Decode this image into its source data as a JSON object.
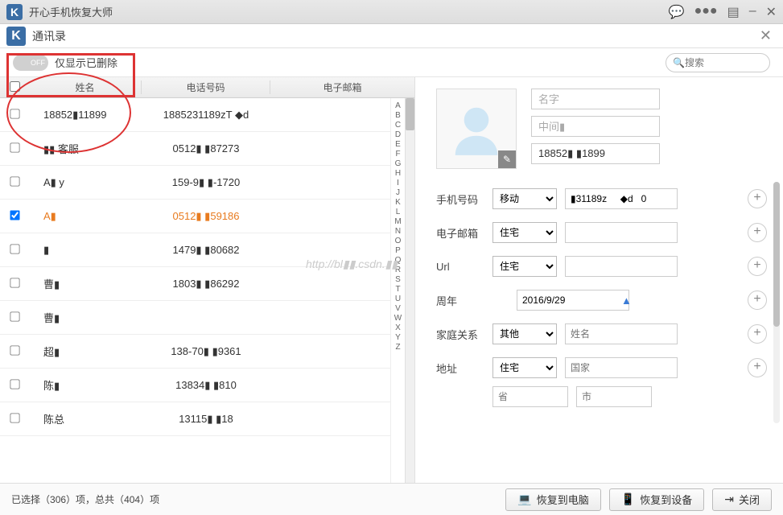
{
  "app": {
    "logo_text": "K",
    "title": "开心手机恢复大师"
  },
  "subheader": {
    "title": "通讯录"
  },
  "toolbar": {
    "toggle_state": "OFF",
    "toggle_label": "仅显示已删除",
    "search_placeholder": "搜索"
  },
  "columns": {
    "name": "姓名",
    "phone": "电话号码",
    "email": "电子邮箱"
  },
  "contacts": [
    {
      "checked": false,
      "name": "18852▮11899",
      "phone": "1885231189zT   ◆d",
      "selected": false
    },
    {
      "checked": false,
      "name": "▮▮  客服",
      "phone": "0512▮  ▮87273",
      "selected": false
    },
    {
      "checked": false,
      "name": "A▮  y",
      "phone": "159-9▮ ▮-1720",
      "selected": false
    },
    {
      "checked": true,
      "name": "A▮",
      "phone": "0512▮  ▮59186",
      "selected": true
    },
    {
      "checked": false,
      "name": "▮",
      "phone": "1479▮ ▮80682",
      "selected": false
    },
    {
      "checked": false,
      "name": "曹▮",
      "phone": "1803▮ ▮86292",
      "selected": false
    },
    {
      "checked": false,
      "name": "曹▮",
      "phone": "",
      "selected": false
    },
    {
      "checked": false,
      "name": "超▮",
      "phone": "138-70▮  ▮9361",
      "selected": false
    },
    {
      "checked": false,
      "name": "陈▮",
      "phone": "13834▮  ▮810",
      "selected": false
    },
    {
      "checked": false,
      "name": "陈总",
      "phone": "13115▮  ▮18",
      "selected": false
    }
  ],
  "az_index": [
    "A",
    "B",
    "C",
    "D",
    "E",
    "F",
    "G",
    "H",
    "I",
    "J",
    "K",
    "L",
    "M",
    "N",
    "O",
    "P",
    "Q",
    "R",
    "S",
    "T",
    "U",
    "V",
    "W",
    "X",
    "Y",
    "Z"
  ],
  "detail": {
    "first_name_placeholder": "名字",
    "middle_name_placeholder": "中间▮",
    "last_name_value": "18852▮ ▮1899",
    "rows": {
      "phone": {
        "label": "手机号码",
        "type": "移动",
        "value": "▮31189z     ◆d   0"
      },
      "email": {
        "label": "电子邮箱",
        "type": "住宅",
        "value": ""
      },
      "url": {
        "label": "Url",
        "type": "住宅",
        "value": ""
      },
      "anniv": {
        "label": "周年",
        "date": "2016/9/29"
      },
      "family": {
        "label": "家庭关系",
        "type": "其他",
        "placeholder": "姓名"
      },
      "addr": {
        "label": "地址",
        "type": "住宅",
        "placeholder": "国家",
        "sub1": "省",
        "sub2": "市"
      }
    }
  },
  "footer": {
    "status_prefix": "已选择（",
    "selected": "306",
    "status_mid": "）项，总共（",
    "total": "404",
    "status_suffix": "）项",
    "btn_pc": "恢复到电脑",
    "btn_device": "恢复到设备",
    "btn_close": "关闭"
  },
  "watermark": "http://bl▮▮.csdn.▮▮"
}
